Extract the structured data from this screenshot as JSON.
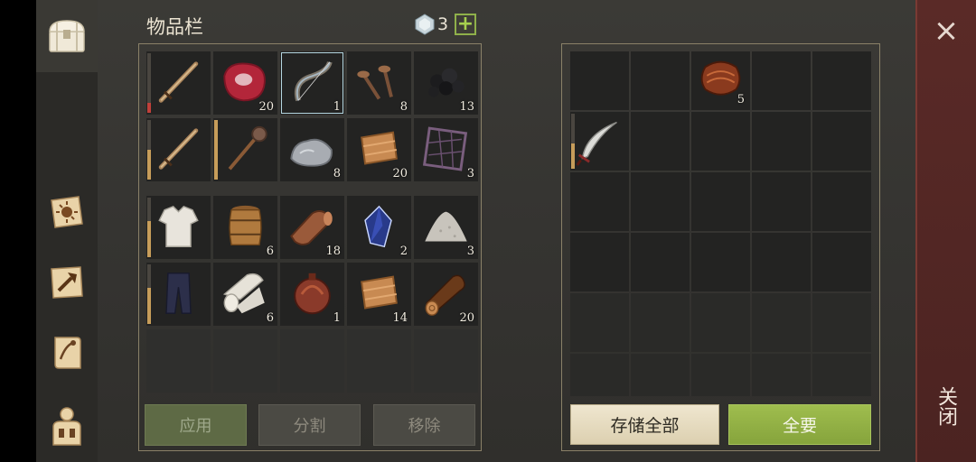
{
  "sidebar": {
    "tabs": [
      {
        "name": "chest-icon",
        "active": true
      },
      {
        "name": "crafting-book-icon",
        "active": false
      },
      {
        "name": "build-hammer-icon",
        "active": false
      },
      {
        "name": "quest-scroll-icon",
        "active": false
      },
      {
        "name": "character-backpack-icon",
        "active": false
      }
    ]
  },
  "inventory": {
    "title": "物品栏",
    "gem_count": "3",
    "add_label": "+",
    "rows": [
      [
        {
          "item": "sword-icon",
          "count": ""
        },
        {
          "item": "raw-meat-icon",
          "count": "20"
        },
        {
          "item": "bow-icon",
          "count": "1"
        },
        {
          "item": "nails-icon",
          "count": "8"
        },
        {
          "item": "coal-icon",
          "count": "13"
        }
      ],
      [
        {
          "item": "sword-icon",
          "count": ""
        },
        {
          "item": "mace-icon",
          "count": ""
        },
        {
          "item": "stone-icon",
          "count": "8"
        },
        {
          "item": "leather-icon",
          "count": "20"
        },
        {
          "item": "net-icon",
          "count": "3"
        }
      ],
      [
        {
          "item": "shirt-icon",
          "count": ""
        },
        {
          "item": "barrel-icon",
          "count": "6"
        },
        {
          "item": "leather-roll-icon",
          "count": "18"
        },
        {
          "item": "crystal-icon",
          "count": "2"
        },
        {
          "item": "salt-pile-icon",
          "count": "3"
        }
      ],
      [
        {
          "item": "pants-icon",
          "count": ""
        },
        {
          "item": "cloth-roll-icon",
          "count": "6"
        },
        {
          "item": "flask-icon",
          "count": "1"
        },
        {
          "item": "leather-icon",
          "count": "14"
        },
        {
          "item": "log-icon",
          "count": "20"
        }
      ]
    ],
    "buttons": {
      "apply": "应用",
      "split": "分割",
      "remove": "移除"
    }
  },
  "storage": {
    "items": [
      {
        "item": "rope-bundle-icon",
        "count": "5"
      },
      {
        "item": "scimitar-icon",
        "count": ""
      }
    ],
    "buttons": {
      "store_all": "存储全部",
      "take_all": "全要"
    }
  },
  "close": {
    "label": "关闭",
    "x": "×"
  },
  "colors": {
    "accent_green": "#9fbd4e",
    "frame": "#8a8168",
    "close_bar": "#5a2a27"
  }
}
